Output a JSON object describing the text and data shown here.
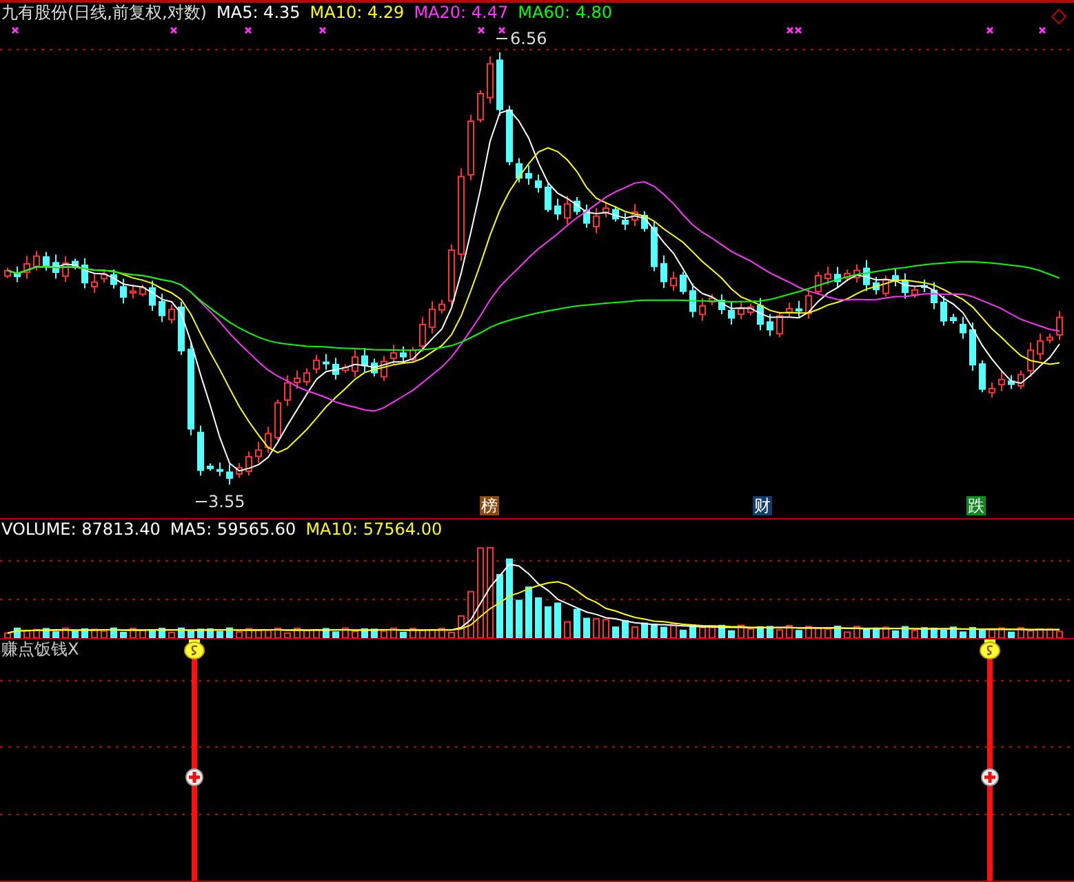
{
  "price_panel": {
    "title": "九有股份(日线,前复权,对数)",
    "indicators": [
      {
        "label": "MA5: 4.35",
        "color": "#ffffff"
      },
      {
        "label": "MA10: 4.29",
        "color": "#ffff00"
      },
      {
        "label": "MA20: 4.47",
        "color": "#ff33ff"
      },
      {
        "label": "MA60: 4.80",
        "color": "#00ff00"
      }
    ],
    "high_label": "6.56",
    "low_label": "3.55",
    "event_tags": [
      {
        "label": "榜",
        "color": "#8a4a10"
      },
      {
        "label": "财",
        "color": "#123d6e"
      },
      {
        "label": "跌",
        "color": "#0c8a1c"
      }
    ]
  },
  "volume_panel": {
    "indicators": [
      {
        "label": "VOLUME: 87813.40",
        "color": "#ffffff"
      },
      {
        "label": "MA5: 59565.60",
        "color": "#ffffff"
      },
      {
        "label": "MA10: 57564.00",
        "color": "#ffff00"
      }
    ]
  },
  "signal_panel": {
    "title": "赚点饭钱X"
  }
}
